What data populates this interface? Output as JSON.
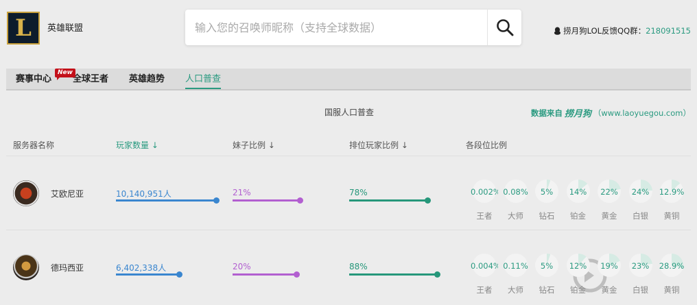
{
  "header": {
    "logo_letter": "L",
    "site_title": "英雄联盟",
    "search_placeholder": "输入您的召唤师昵称（支持全球数据）",
    "qq_label": "捞月狗LOL反馈QQ群：",
    "qq_number": "218091515"
  },
  "nav": {
    "items": [
      "赛事中心",
      "全球王者",
      "英雄趋势",
      "人口普查"
    ],
    "active": "人口普查",
    "badge": "New"
  },
  "panel": {
    "title": "国服人口普查",
    "source_label": "数据来自",
    "source_brand": "捞月狗",
    "source_url": "（www.laoyuegou.com）"
  },
  "columns": [
    "服务器名称",
    "玩家数量 ↓",
    "妹子比例 ↓",
    "排位玩家比例 ↓",
    "各段位比例"
  ],
  "tier_labels": [
    "王者",
    "大师",
    "钻石",
    "铂金",
    "黄金",
    "白银",
    "黄铜"
  ],
  "colors": {
    "accent": "#2a9a80",
    "players_bar": "#3a86cf",
    "female_bar": "#b25fd0",
    "ranked_bar": "#26977a"
  },
  "servers": [
    {
      "name": "艾欧尼亚",
      "players": "10,140,951人",
      "players_fraction": 1.0,
      "female": "21%",
      "female_fraction": 0.21,
      "ranked": "78%",
      "ranked_fraction": 0.78,
      "tiers": [
        "0.002%",
        "0.08%",
        "5%",
        "14%",
        "22%",
        "24%",
        "12.9%"
      ]
    },
    {
      "name": "德玛西亚",
      "players": "6,402,338人",
      "players_fraction": 0.63,
      "female": "20%",
      "female_fraction": 0.2,
      "ranked": "88%",
      "ranked_fraction": 0.88,
      "tiers": [
        "0.004%",
        "0.11%",
        "5%",
        "12%",
        "19%",
        "23%",
        "28.9%"
      ]
    }
  ]
}
